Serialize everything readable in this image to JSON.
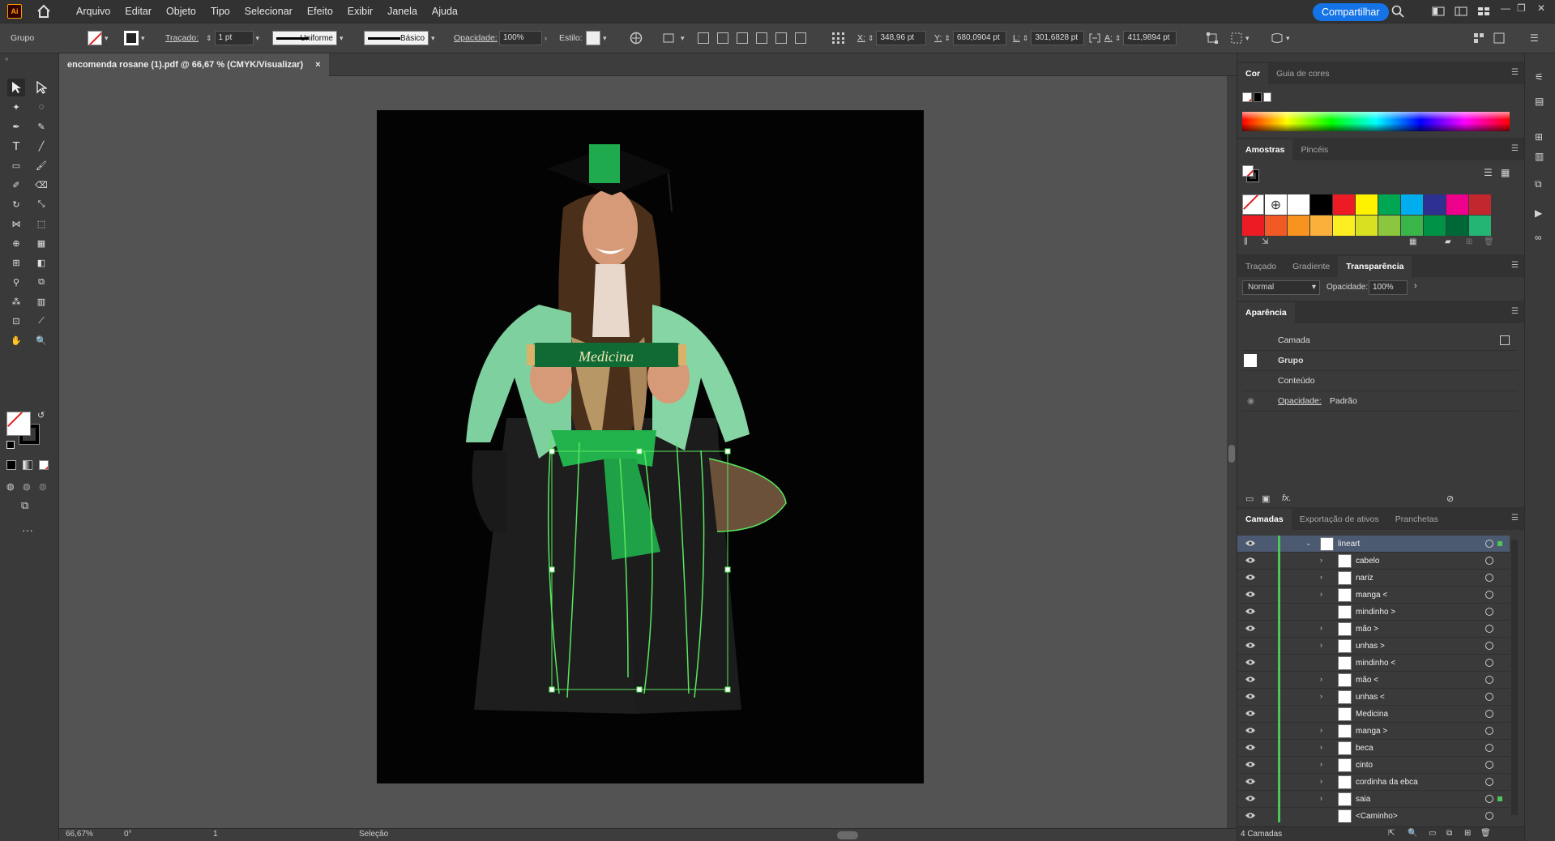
{
  "app": {
    "logo_text": "Ai"
  },
  "menu": [
    "Arquivo",
    "Editar",
    "Objeto",
    "Tipo",
    "Selecionar",
    "Efeito",
    "Exibir",
    "Janela",
    "Ajuda"
  ],
  "share_label": "Compartilhar",
  "control": {
    "object_type": "Grupo",
    "stroke_label": "Traçado:",
    "stroke_weight": "1 pt",
    "profile": "Uniforme",
    "brush": "Básico",
    "opacity_label": "Opacidade:",
    "opacity": "100%",
    "style_label": "Estilo:",
    "x_label": "X:",
    "x": "348,96 pt",
    "y_label": "Y:",
    "y": "680,0904 pt",
    "w_label": "L:",
    "w": "301,6828 pt",
    "h_label": "A:",
    "h": "411,9894 pt"
  },
  "document_tab": {
    "title": "encomenda rosane (1).pdf @ 66,67 % (CMYK/Visualizar)",
    "close": "×"
  },
  "status": {
    "zoom": "66,67%",
    "rotation": "0°",
    "artboard": "1",
    "tool": "Seleção"
  },
  "artwork": {
    "diploma_text": "Medicina"
  },
  "color_panel": {
    "tabs": [
      "Cor",
      "Guia de cores"
    ]
  },
  "swatches_panel": {
    "tabs": [
      "Amostras",
      "Pincéis"
    ],
    "row1": [
      "#ffffff",
      "#000000",
      "#ed1c24",
      "#fff200",
      "#00a651",
      "#00aeef",
      "#2e3192",
      "#ec008c",
      "#c1272d"
    ],
    "row2": [
      "#ed1c24",
      "#f15a24",
      "#f7931e",
      "#fbb03b",
      "#fcee21",
      "#d9e021",
      "#8cc63f",
      "#39b54a",
      "#009245",
      "#006837",
      "#22b573"
    ]
  },
  "transparency_panel": {
    "tabs": [
      "Traçado",
      "Gradiente",
      "Transparência"
    ],
    "blend_mode": "Normal",
    "opacity_label": "Opacidade:",
    "opacity": "100%"
  },
  "appearance_panel": {
    "title": "Aparência",
    "layer": "Camada",
    "group": "Grupo",
    "content": "Conteúdo",
    "opacity_label": "Opacidade:",
    "opacity_value": "Padrão",
    "fx": "fx."
  },
  "layers_panel": {
    "tabs": [
      "Camadas",
      "Exportação de ativos",
      "Pranchetas"
    ],
    "rows": [
      {
        "name": "lineart",
        "twirl": "⌄",
        "level": 0
      },
      {
        "name": "cabelo",
        "twirl": "›",
        "level": 1
      },
      {
        "name": "nariz",
        "twirl": "›",
        "level": 1
      },
      {
        "name": "manga <",
        "twirl": "›",
        "level": 1
      },
      {
        "name": "mindinho >",
        "twirl": "",
        "level": 1
      },
      {
        "name": "mão >",
        "twirl": "›",
        "level": 1
      },
      {
        "name": "unhas >",
        "twirl": "›",
        "level": 1
      },
      {
        "name": "mindinho <",
        "twirl": "",
        "level": 1
      },
      {
        "name": "mão <",
        "twirl": "›",
        "level": 1
      },
      {
        "name": "unhas <",
        "twirl": "›",
        "level": 1
      },
      {
        "name": "Medicina",
        "twirl": "",
        "level": 1
      },
      {
        "name": "manga >",
        "twirl": "›",
        "level": 1
      },
      {
        "name": "beca",
        "twirl": "›",
        "level": 1
      },
      {
        "name": "cinto",
        "twirl": "›",
        "level": 1
      },
      {
        "name": "cordinha da ebca",
        "twirl": "›",
        "level": 1
      },
      {
        "name": "saia",
        "twirl": "›",
        "level": 1
      },
      {
        "name": "<Caminho>",
        "twirl": "",
        "level": 1
      }
    ],
    "footer": "4 Camadas"
  }
}
